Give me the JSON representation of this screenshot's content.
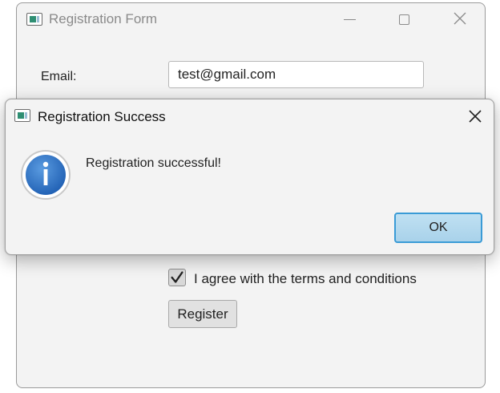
{
  "main_window": {
    "title": "Registration Form",
    "icon": "app-icon",
    "window_controls": [
      "minimize-icon",
      "maximize-icon",
      "close-icon"
    ],
    "email_label": "Email:",
    "email_value": "test@gmail.com",
    "terms_label": "I agree with the terms and conditions",
    "terms_checked": true,
    "register_label": "Register"
  },
  "dialog": {
    "title": "Registration Success",
    "icon": "info-icon",
    "message": "Registration successful!",
    "ok_label": "OK",
    "close_icon": "close-icon"
  },
  "colors": {
    "window_bg": "#f3f3f3",
    "ok_button_bg": "#a9d2ea",
    "ok_button_border": "#3a9bd6",
    "info_icon_blue": "#2b72c8"
  }
}
